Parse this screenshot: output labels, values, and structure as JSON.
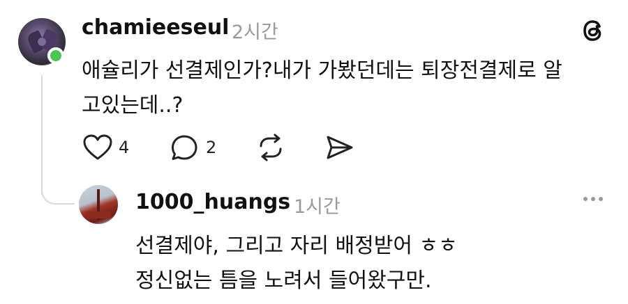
{
  "comments": [
    {
      "username": "chamieeseul",
      "time": "2시간",
      "lines": [
        "애슐리가 선결제인가?내가 가봤던데는 퇴장전결제로 알",
        "고있는데..?"
      ],
      "likes": "4",
      "replies": "2"
    },
    {
      "username": "1000_huangs",
      "time": "1시간",
      "lines": [
        "선결제야, 그리고 자리 배정받어 ㅎㅎ",
        "정신없는 틈을 노려서 들어왔구만."
      ]
    }
  ],
  "icons": {
    "logo": "threads-logo-icon",
    "like": "heart-icon",
    "reply": "comment-icon",
    "repost": "repost-icon",
    "share": "send-icon",
    "more": "more-icon"
  },
  "colors": {
    "online": "#4cc552",
    "muted": "#999999",
    "line": "#d9d9d9"
  }
}
